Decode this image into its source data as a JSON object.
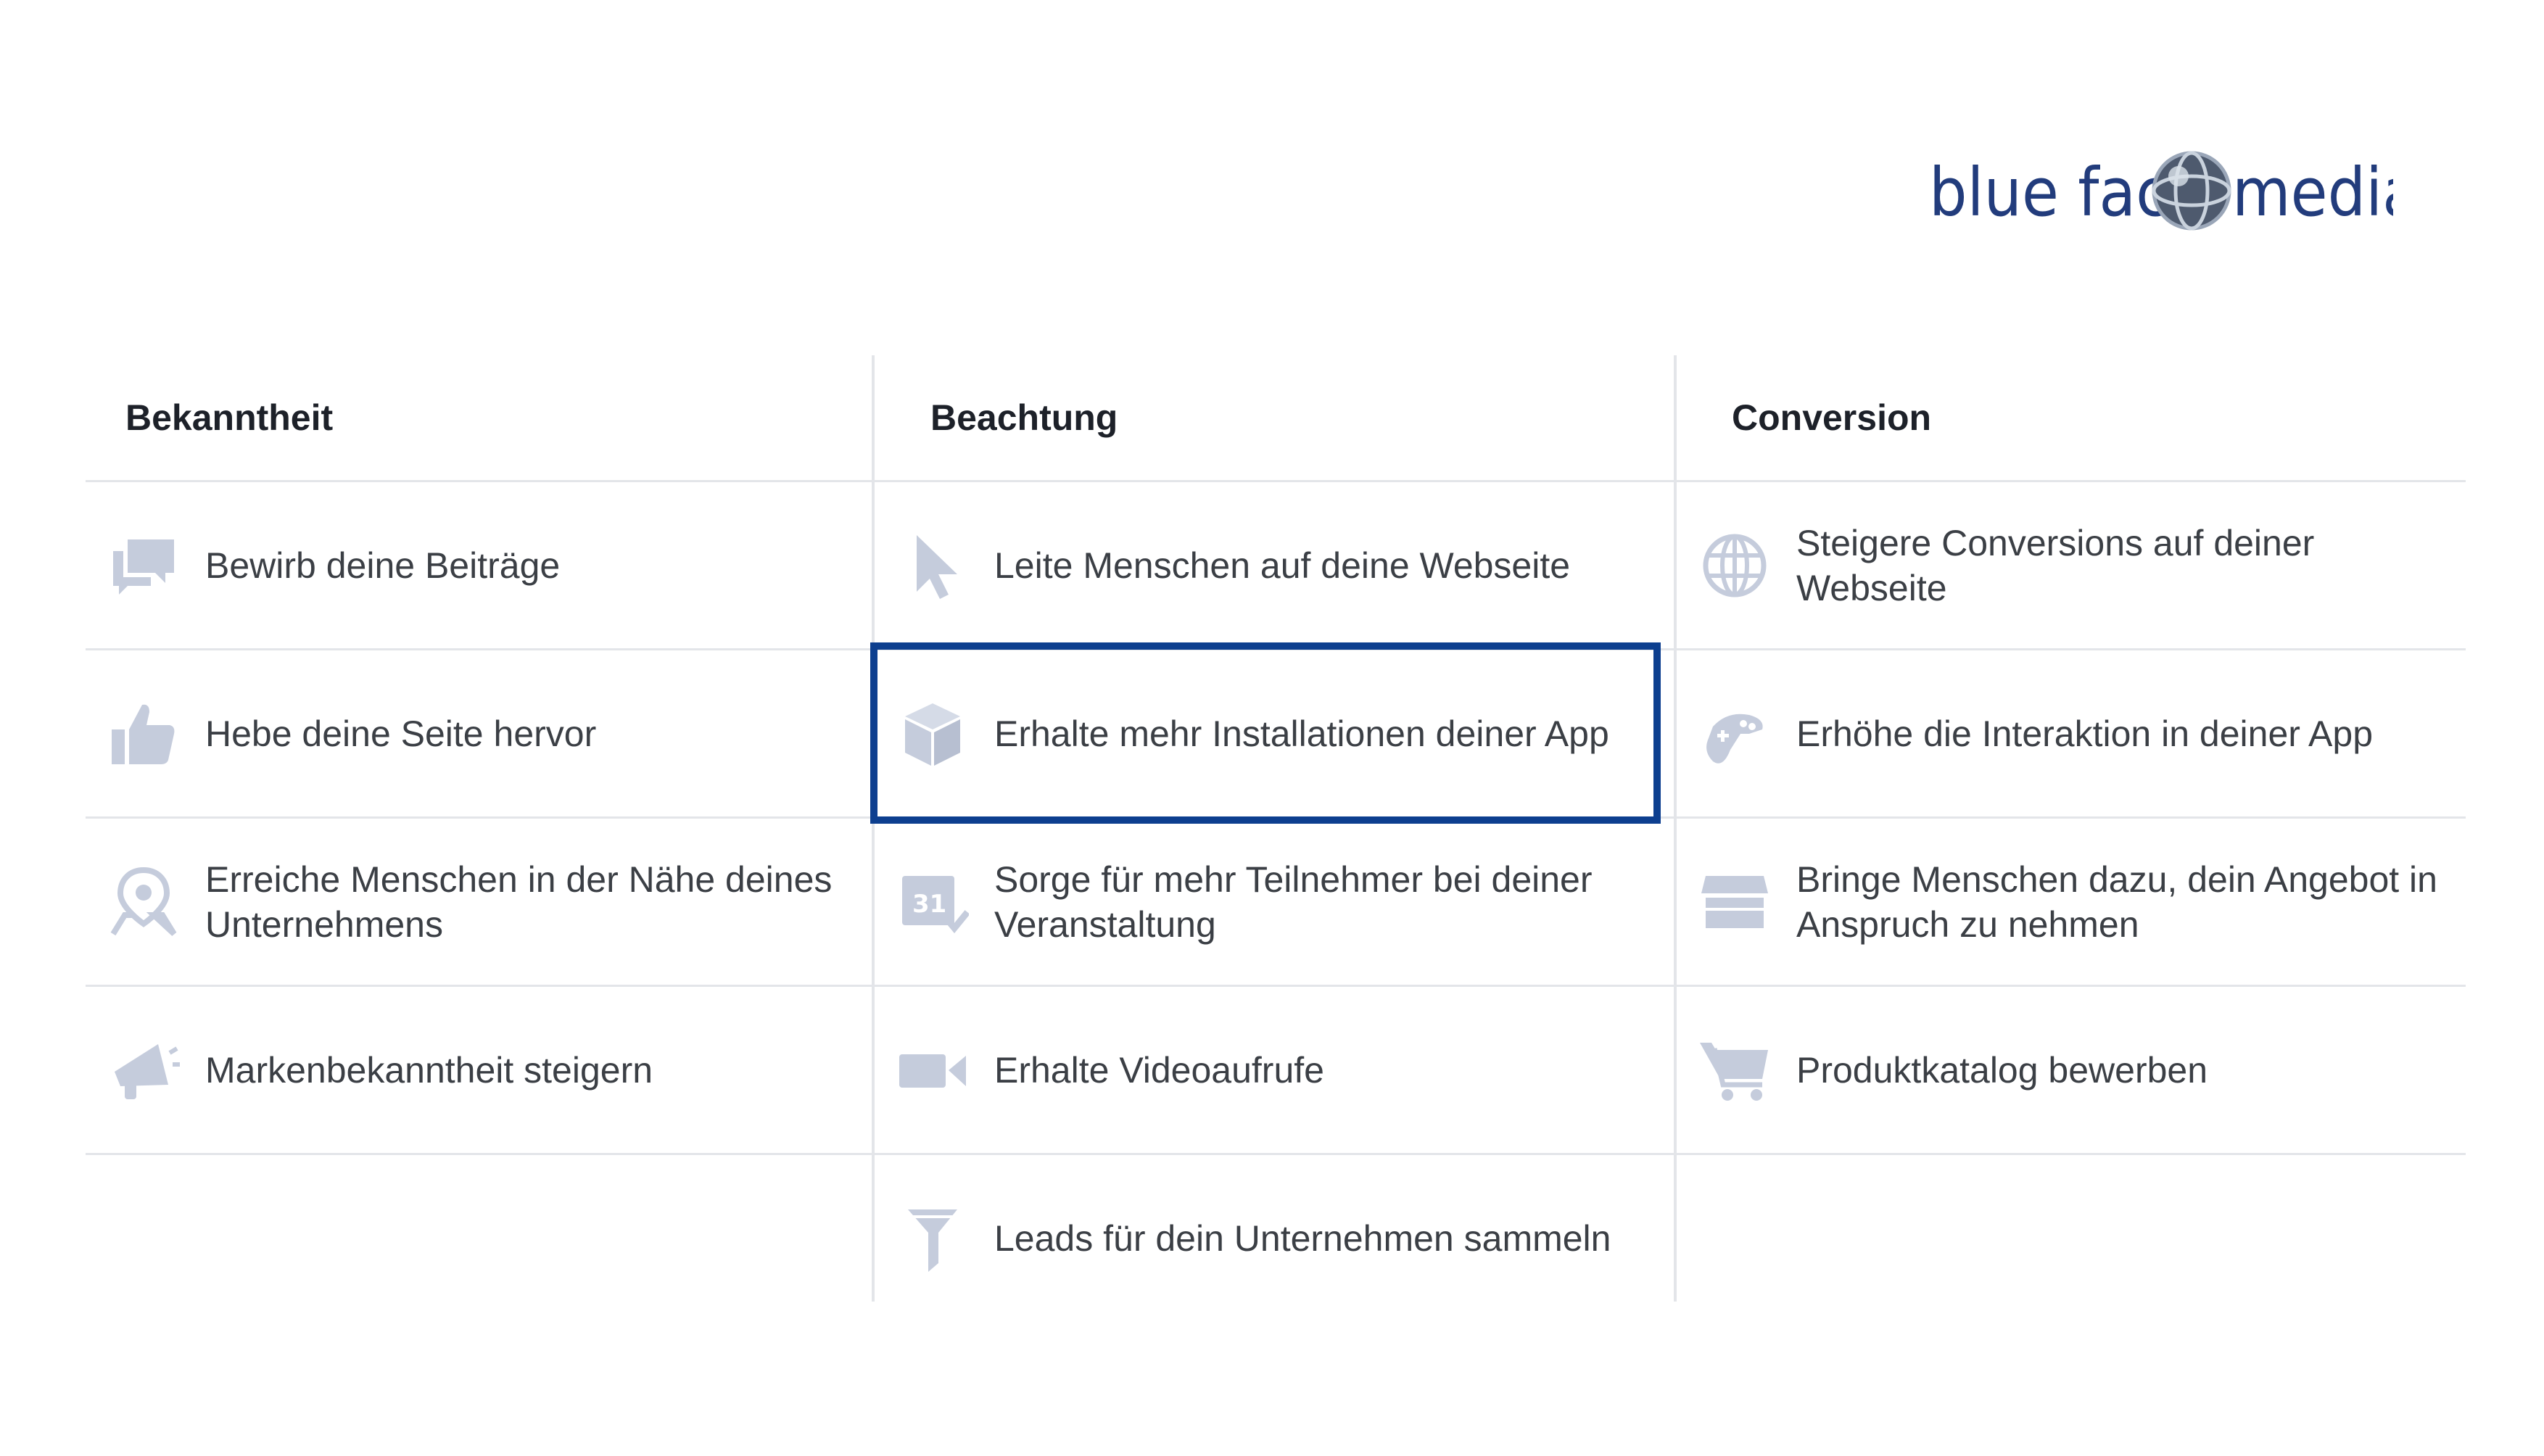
{
  "brand": {
    "part1": "blue face",
    "part2": "media",
    "icon": "globe-icon",
    "color": "#223c7c"
  },
  "columns": [
    {
      "header": "Bekanntheit",
      "items": [
        {
          "label": "Bewirb deine Beiträge",
          "icon": "chat-bubbles-icon"
        },
        {
          "label": "Hebe deine Seite hervor",
          "icon": "thumbs-up-icon"
        },
        {
          "label": "Erreiche Menschen in der Nähe deines Unternehmens",
          "icon": "location-pin-icon"
        },
        {
          "label": "Markenbekanntheit steigern",
          "icon": "megaphone-icon"
        }
      ]
    },
    {
      "header": "Beachtung",
      "items": [
        {
          "label": "Leite Menschen auf deine Webseite",
          "icon": "cursor-icon"
        },
        {
          "label": "Erhalte mehr Installationen deiner App",
          "icon": "cube-icon",
          "selected": true
        },
        {
          "label": "Sorge für mehr Teilnehmer bei deiner Veranstaltung",
          "icon": "calendar-icon"
        },
        {
          "label": "Erhalte Videoaufrufe",
          "icon": "video-camera-icon"
        },
        {
          "label": "Leads für dein Unternehmen sammeln",
          "icon": "funnel-icon"
        }
      ]
    },
    {
      "header": "Conversion",
      "items": [
        {
          "label": "Steigere Conversions auf deiner Webseite",
          "icon": "globe-icon"
        },
        {
          "label": "Erhöhe die Interaktion in deiner App",
          "icon": "game-controller-icon"
        },
        {
          "label": "Bringe Menschen dazu, dein Angebot in Anspruch zu nehmen",
          "icon": "storefront-icon"
        },
        {
          "label": "Produktkatalog bewerben",
          "icon": "shopping-cart-icon"
        }
      ]
    }
  ],
  "colors": {
    "icon": "#c5ccdc",
    "text": "#3b3f45",
    "header": "#1d2129",
    "divider": "#e3e5e9",
    "selection": "#0d3f8f"
  }
}
